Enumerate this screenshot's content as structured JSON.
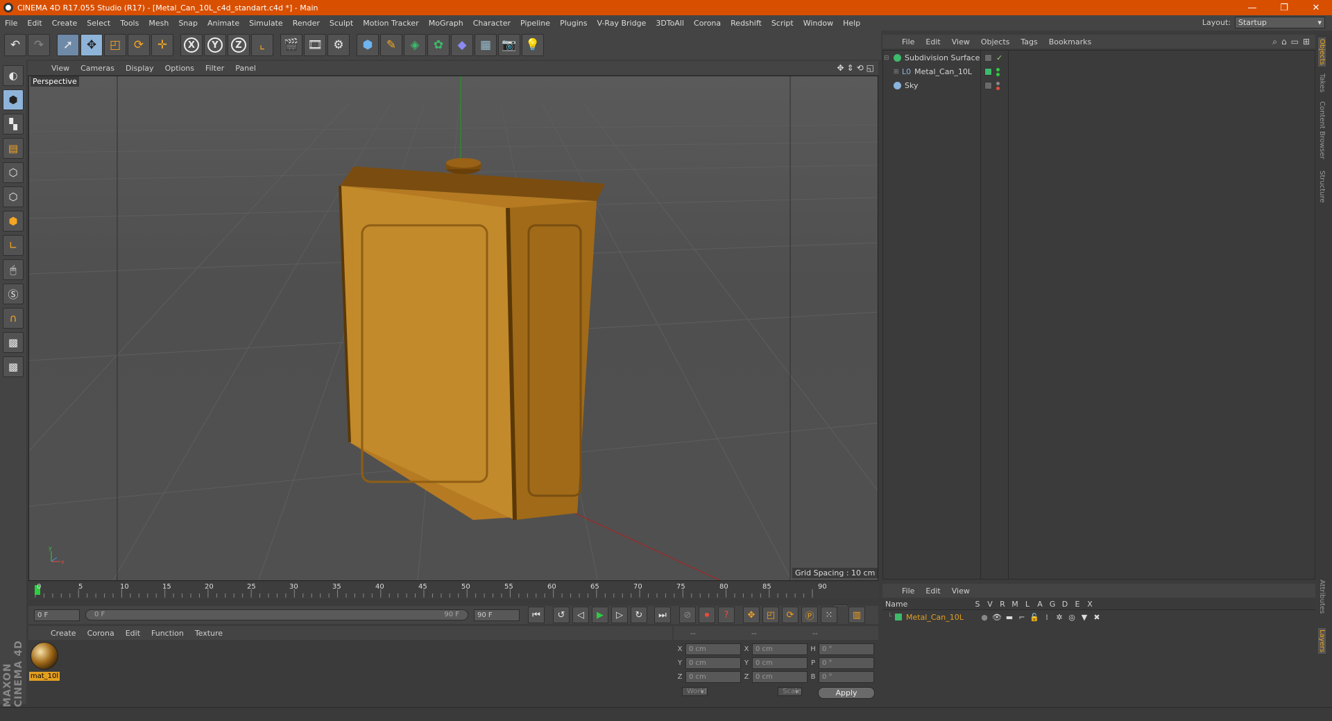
{
  "window": {
    "title": "CINEMA 4D R17.055 Studio (R17) - [Metal_Can_10L_c4d_standart.c4d *] - Main",
    "controls": [
      "—",
      "❐",
      "✕"
    ]
  },
  "menubar": {
    "items": [
      "File",
      "Edit",
      "Create",
      "Select",
      "Tools",
      "Mesh",
      "Snap",
      "Animate",
      "Simulate",
      "Render",
      "Sculpt",
      "Motion Tracker",
      "MoGraph",
      "Character",
      "Pipeline",
      "Plugins",
      "V-Ray Bridge",
      "3DToAll",
      "Corona",
      "Redshift",
      "Script",
      "Window",
      "Help"
    ],
    "layout_label": "Layout:",
    "layout_value": "Startup"
  },
  "toolbar": {
    "icons": [
      "undo-icon",
      "redo-icon",
      "live-selection-icon",
      "move-icon",
      "scale-icon",
      "rotate-icon",
      "recent-tool-icon",
      "x-axis-icon",
      "y-axis-icon",
      "z-axis-icon",
      "coordinate-system-icon",
      "render-view-icon",
      "render-picture-viewer-icon",
      "edit-render-settings-icon",
      "cube-icon",
      "pen-icon",
      "subdivision-icon",
      "array-icon",
      "deformer-icon",
      "floor-icon",
      "camera-icon",
      "light-icon"
    ],
    "axis_x": "X",
    "axis_y": "Y",
    "axis_z": "Z"
  },
  "viewport": {
    "menu": [
      "View",
      "Cameras",
      "Display",
      "Options",
      "Filter",
      "Panel"
    ],
    "label": "Perspective",
    "grid_spacing": "Grid Spacing : 10 cm"
  },
  "timeline": {
    "ticks": [
      "0",
      "5",
      "10",
      "15",
      "20",
      "25",
      "30",
      "35",
      "40",
      "45",
      "50",
      "55",
      "60",
      "65",
      "70",
      "75",
      "80",
      "85",
      "90"
    ],
    "current_frame": "0 F",
    "start": "0 F",
    "slider_left": "0 F",
    "slider_right": "90 F",
    "end": "90 F"
  },
  "material_manager": {
    "menu": [
      "Create",
      "Corona",
      "Edit",
      "Function",
      "Texture"
    ],
    "materials": [
      {
        "name": "mat_10l"
      }
    ]
  },
  "coordinates": {
    "headers": [
      "--",
      "--",
      "--"
    ],
    "rows": [
      {
        "a": "X",
        "av": "0 cm",
        "b": "X",
        "bv": "0 cm",
        "c": "H",
        "cv": "0 °"
      },
      {
        "a": "Y",
        "av": "0 cm",
        "b": "Y",
        "bv": "0 cm",
        "c": "P",
        "cv": "0 °"
      },
      {
        "a": "Z",
        "av": "0 cm",
        "b": "Z",
        "bv": "0 cm",
        "c": "B",
        "cv": "0 °"
      }
    ],
    "mode": "World",
    "size_mode": "Scale",
    "apply": "Apply"
  },
  "object_manager": {
    "menu": [
      "File",
      "Edit",
      "View",
      "Objects",
      "Tags",
      "Bookmarks"
    ],
    "objects": [
      {
        "name": "Subdivision Surface",
        "color": "#3dbb6b"
      },
      {
        "name": "Metal_Can_10L",
        "color": "#8bb4dd"
      },
      {
        "name": "Sky",
        "color": "#8bb4dd"
      }
    ]
  },
  "side_tabs": [
    "Objects",
    "Takes",
    "Content Browser",
    "Structure",
    "Attributes",
    "Layers"
  ],
  "layers": {
    "menu": [
      "File",
      "Edit",
      "View"
    ],
    "columns": [
      "Name",
      "S",
      "V",
      "R",
      "M",
      "L",
      "A",
      "G",
      "D",
      "E",
      "X"
    ],
    "rows": [
      {
        "name": "Metal_Can_10L"
      }
    ]
  },
  "brand": "MAXON CINEMA 4D"
}
